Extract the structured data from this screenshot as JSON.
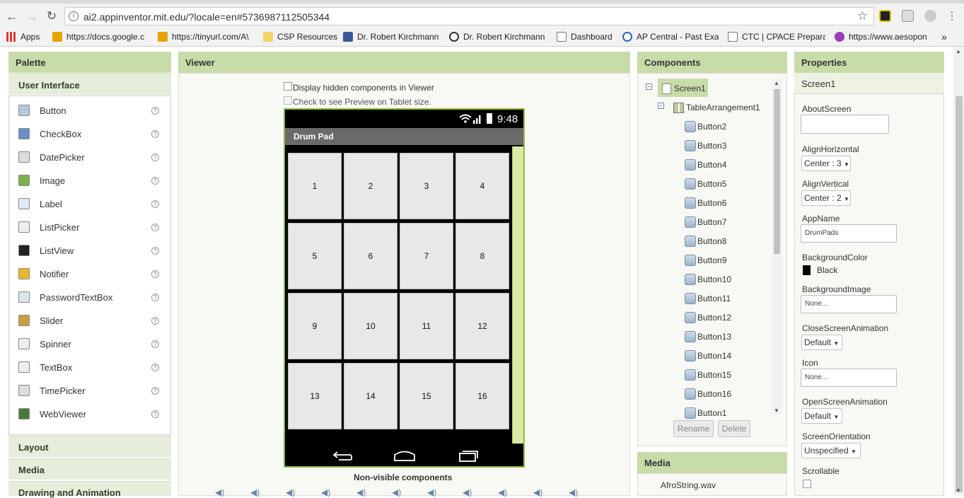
{
  "browser": {
    "url": "ai2.appinventor.mit.edu/?locale=en#5736987112505344",
    "bookmarks": [
      {
        "label": "Apps",
        "icon": "apps-grid-icon"
      },
      {
        "label": "https://docs.google.c",
        "icon": "orange-bookmark-icon"
      },
      {
        "label": "https://tinyurl.com/A\\",
        "icon": "orange-bookmark-icon"
      },
      {
        "label": "CSP Resources",
        "icon": "folder-icon"
      },
      {
        "label": "Dr. Robert Kirchmann",
        "icon": "facebook-icon"
      },
      {
        "label": "Dr. Robert Kirchmann",
        "icon": "quora-icon"
      },
      {
        "label": "Dashboard",
        "icon": "page-icon"
      },
      {
        "label": "AP Central - Past Exa",
        "icon": "ap-icon"
      },
      {
        "label": "CTC | CPACE Preparat",
        "icon": "page-icon"
      },
      {
        "label": "https://www.aesopon",
        "icon": "aesop-icon"
      }
    ],
    "more": "»"
  },
  "palette": {
    "title": "Palette",
    "category_open": "User Interface",
    "items": [
      {
        "label": "Button",
        "icon": "button-icon"
      },
      {
        "label": "CheckBox",
        "icon": "checkbox-icon"
      },
      {
        "label": "DatePicker",
        "icon": "calendar-icon"
      },
      {
        "label": "Image",
        "icon": "image-icon"
      },
      {
        "label": "Label",
        "icon": "label-icon"
      },
      {
        "label": "ListPicker",
        "icon": "listpicker-icon"
      },
      {
        "label": "ListView",
        "icon": "listview-icon"
      },
      {
        "label": "Notifier",
        "icon": "warning-icon"
      },
      {
        "label": "PasswordTextBox",
        "icon": "password-icon"
      },
      {
        "label": "Slider",
        "icon": "slider-icon"
      },
      {
        "label": "Spinner",
        "icon": "spinner-icon"
      },
      {
        "label": "TextBox",
        "icon": "textbox-icon"
      },
      {
        "label": "TimePicker",
        "icon": "clock-icon"
      },
      {
        "label": "WebViewer",
        "icon": "globe-icon"
      }
    ],
    "help_glyph": "?",
    "categories": [
      "Layout",
      "Media",
      "Drawing and Animation"
    ]
  },
  "viewer": {
    "title": "Viewer",
    "hidden_label": "Display hidden components in Viewer",
    "tablet_label": "Check to see Preview on Tablet size.",
    "status_time": "9:48",
    "app_title": "Drum Pad",
    "pads": [
      "1",
      "2",
      "3",
      "4",
      "5",
      "6",
      "7",
      "8",
      "9",
      "10",
      "11",
      "12",
      "13",
      "14",
      "15",
      "16"
    ],
    "nonvisible_label": "Non-visible components"
  },
  "components": {
    "title": "Components",
    "screen": "Screen1",
    "arrangement": "TableArrangement1",
    "buttons": [
      "Button2",
      "Button3",
      "Button4",
      "Button5",
      "Button6",
      "Button7",
      "Button8",
      "Button9",
      "Button10",
      "Button11",
      "Button12",
      "Button13",
      "Button14",
      "Button15",
      "Button16",
      "Button1"
    ],
    "rename": "Rename",
    "delete": "Delete"
  },
  "media": {
    "title": "Media",
    "files": [
      "AfroString.wav"
    ]
  },
  "properties": {
    "title": "Properties",
    "component": "Screen1",
    "about_label": "AboutScreen",
    "align_h_label": "AlignHorizontal",
    "align_h_value": "Center : 3",
    "align_v_label": "AlignVertical",
    "align_v_value": "Center : 2",
    "appname_label": "AppName",
    "appname_value": "DrumPads",
    "bgcolor_label": "BackgroundColor",
    "bgcolor_value": "Black",
    "bgimage_label": "BackgroundImage",
    "bgimage_value": "None...",
    "close_anim_label": "CloseScreenAnimation",
    "close_anim_value": "Default",
    "icon_label": "Icon",
    "icon_value": "None...",
    "open_anim_label": "OpenScreenAnimation",
    "open_anim_value": "Default",
    "orientation_label": "ScreenOrientation",
    "orientation_value": "Unspecified",
    "scrollable_label": "Scrollable"
  },
  "colors": {
    "panel_header": "#c8dcaa",
    "phone_border": "#8cbf3f",
    "pad_fill": "#e8e8e8",
    "selected_node": "#c8dcaa"
  }
}
